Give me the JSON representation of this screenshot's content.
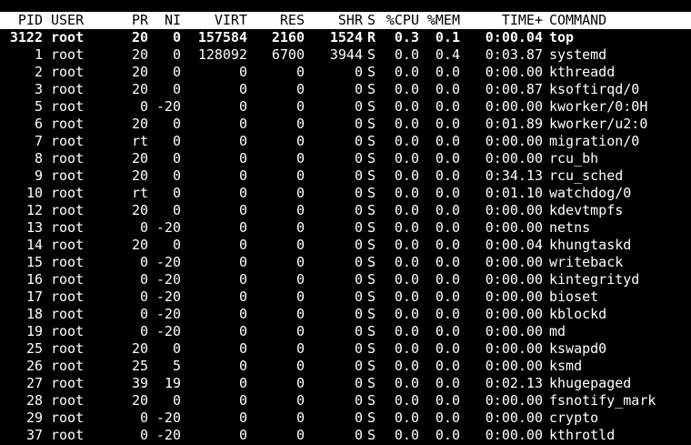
{
  "columns": {
    "pid": "PID",
    "user": "USER",
    "pr": "PR",
    "ni": "NI",
    "virt": "VIRT",
    "res": "RES",
    "shr": "SHR",
    "s": "S",
    "cpu": "%CPU",
    "mem": "%MEM",
    "time": "TIME+",
    "command": "COMMAND"
  },
  "colors": {
    "background": "#000000",
    "text": "#ffffff",
    "header_background": "#ffffff",
    "header_text": "#000000"
  },
  "processes": [
    {
      "pid": "3122",
      "user": "root",
      "pr": "20",
      "ni": "0",
      "virt": "157584",
      "res": "2160",
      "shr": "1524",
      "s": "R",
      "cpu": "0.3",
      "mem": "0.1",
      "time": "0:00.04",
      "command": "top",
      "highlight": true
    },
    {
      "pid": "1",
      "user": "root",
      "pr": "20",
      "ni": "0",
      "virt": "128092",
      "res": "6700",
      "shr": "3944",
      "s": "S",
      "cpu": "0.0",
      "mem": "0.4",
      "time": "0:03.87",
      "command": "systemd",
      "highlight": false
    },
    {
      "pid": "2",
      "user": "root",
      "pr": "20",
      "ni": "0",
      "virt": "0",
      "res": "0",
      "shr": "0",
      "s": "S",
      "cpu": "0.0",
      "mem": "0.0",
      "time": "0:00.00",
      "command": "kthreadd",
      "highlight": false
    },
    {
      "pid": "3",
      "user": "root",
      "pr": "20",
      "ni": "0",
      "virt": "0",
      "res": "0",
      "shr": "0",
      "s": "S",
      "cpu": "0.0",
      "mem": "0.0",
      "time": "0:00.87",
      "command": "ksoftirqd/0",
      "highlight": false
    },
    {
      "pid": "5",
      "user": "root",
      "pr": "0",
      "ni": "-20",
      "virt": "0",
      "res": "0",
      "shr": "0",
      "s": "S",
      "cpu": "0.0",
      "mem": "0.0",
      "time": "0:00.00",
      "command": "kworker/0:0H",
      "highlight": false
    },
    {
      "pid": "6",
      "user": "root",
      "pr": "20",
      "ni": "0",
      "virt": "0",
      "res": "0",
      "shr": "0",
      "s": "S",
      "cpu": "0.0",
      "mem": "0.0",
      "time": "0:01.89",
      "command": "kworker/u2:0",
      "highlight": false
    },
    {
      "pid": "7",
      "user": "root",
      "pr": "rt",
      "ni": "0",
      "virt": "0",
      "res": "0",
      "shr": "0",
      "s": "S",
      "cpu": "0.0",
      "mem": "0.0",
      "time": "0:00.00",
      "command": "migration/0",
      "highlight": false
    },
    {
      "pid": "8",
      "user": "root",
      "pr": "20",
      "ni": "0",
      "virt": "0",
      "res": "0",
      "shr": "0",
      "s": "S",
      "cpu": "0.0",
      "mem": "0.0",
      "time": "0:00.00",
      "command": "rcu_bh",
      "highlight": false
    },
    {
      "pid": "9",
      "user": "root",
      "pr": "20",
      "ni": "0",
      "virt": "0",
      "res": "0",
      "shr": "0",
      "s": "S",
      "cpu": "0.0",
      "mem": "0.0",
      "time": "0:34.13",
      "command": "rcu_sched",
      "highlight": false
    },
    {
      "pid": "10",
      "user": "root",
      "pr": "rt",
      "ni": "0",
      "virt": "0",
      "res": "0",
      "shr": "0",
      "s": "S",
      "cpu": "0.0",
      "mem": "0.0",
      "time": "0:01.10",
      "command": "watchdog/0",
      "highlight": false
    },
    {
      "pid": "12",
      "user": "root",
      "pr": "20",
      "ni": "0",
      "virt": "0",
      "res": "0",
      "shr": "0",
      "s": "S",
      "cpu": "0.0",
      "mem": "0.0",
      "time": "0:00.00",
      "command": "kdevtmpfs",
      "highlight": false
    },
    {
      "pid": "13",
      "user": "root",
      "pr": "0",
      "ni": "-20",
      "virt": "0",
      "res": "0",
      "shr": "0",
      "s": "S",
      "cpu": "0.0",
      "mem": "0.0",
      "time": "0:00.00",
      "command": "netns",
      "highlight": false
    },
    {
      "pid": "14",
      "user": "root",
      "pr": "20",
      "ni": "0",
      "virt": "0",
      "res": "0",
      "shr": "0",
      "s": "S",
      "cpu": "0.0",
      "mem": "0.0",
      "time": "0:00.04",
      "command": "khungtaskd",
      "highlight": false
    },
    {
      "pid": "15",
      "user": "root",
      "pr": "0",
      "ni": "-20",
      "virt": "0",
      "res": "0",
      "shr": "0",
      "s": "S",
      "cpu": "0.0",
      "mem": "0.0",
      "time": "0:00.00",
      "command": "writeback",
      "highlight": false
    },
    {
      "pid": "16",
      "user": "root",
      "pr": "0",
      "ni": "-20",
      "virt": "0",
      "res": "0",
      "shr": "0",
      "s": "S",
      "cpu": "0.0",
      "mem": "0.0",
      "time": "0:00.00",
      "command": "kintegrityd",
      "highlight": false
    },
    {
      "pid": "17",
      "user": "root",
      "pr": "0",
      "ni": "-20",
      "virt": "0",
      "res": "0",
      "shr": "0",
      "s": "S",
      "cpu": "0.0",
      "mem": "0.0",
      "time": "0:00.00",
      "command": "bioset",
      "highlight": false
    },
    {
      "pid": "18",
      "user": "root",
      "pr": "0",
      "ni": "-20",
      "virt": "0",
      "res": "0",
      "shr": "0",
      "s": "S",
      "cpu": "0.0",
      "mem": "0.0",
      "time": "0:00.00",
      "command": "kblockd",
      "highlight": false
    },
    {
      "pid": "19",
      "user": "root",
      "pr": "0",
      "ni": "-20",
      "virt": "0",
      "res": "0",
      "shr": "0",
      "s": "S",
      "cpu": "0.0",
      "mem": "0.0",
      "time": "0:00.00",
      "command": "md",
      "highlight": false
    },
    {
      "pid": "25",
      "user": "root",
      "pr": "20",
      "ni": "0",
      "virt": "0",
      "res": "0",
      "shr": "0",
      "s": "S",
      "cpu": "0.0",
      "mem": "0.0",
      "time": "0:00.00",
      "command": "kswapd0",
      "highlight": false
    },
    {
      "pid": "26",
      "user": "root",
      "pr": "25",
      "ni": "5",
      "virt": "0",
      "res": "0",
      "shr": "0",
      "s": "S",
      "cpu": "0.0",
      "mem": "0.0",
      "time": "0:00.00",
      "command": "ksmd",
      "highlight": false
    },
    {
      "pid": "27",
      "user": "root",
      "pr": "39",
      "ni": "19",
      "virt": "0",
      "res": "0",
      "shr": "0",
      "s": "S",
      "cpu": "0.0",
      "mem": "0.0",
      "time": "0:02.13",
      "command": "khugepaged",
      "highlight": false
    },
    {
      "pid": "28",
      "user": "root",
      "pr": "20",
      "ni": "0",
      "virt": "0",
      "res": "0",
      "shr": "0",
      "s": "S",
      "cpu": "0.0",
      "mem": "0.0",
      "time": "0:00.00",
      "command": "fsnotify_mark",
      "highlight": false
    },
    {
      "pid": "29",
      "user": "root",
      "pr": "0",
      "ni": "-20",
      "virt": "0",
      "res": "0",
      "shr": "0",
      "s": "S",
      "cpu": "0.0",
      "mem": "0.0",
      "time": "0:00.00",
      "command": "crypto",
      "highlight": false
    },
    {
      "pid": "37",
      "user": "root",
      "pr": "0",
      "ni": "-20",
      "virt": "0",
      "res": "0",
      "shr": "0",
      "s": "S",
      "cpu": "0.0",
      "mem": "0.0",
      "time": "0:00.00",
      "command": "kthrotld",
      "highlight": false
    }
  ]
}
